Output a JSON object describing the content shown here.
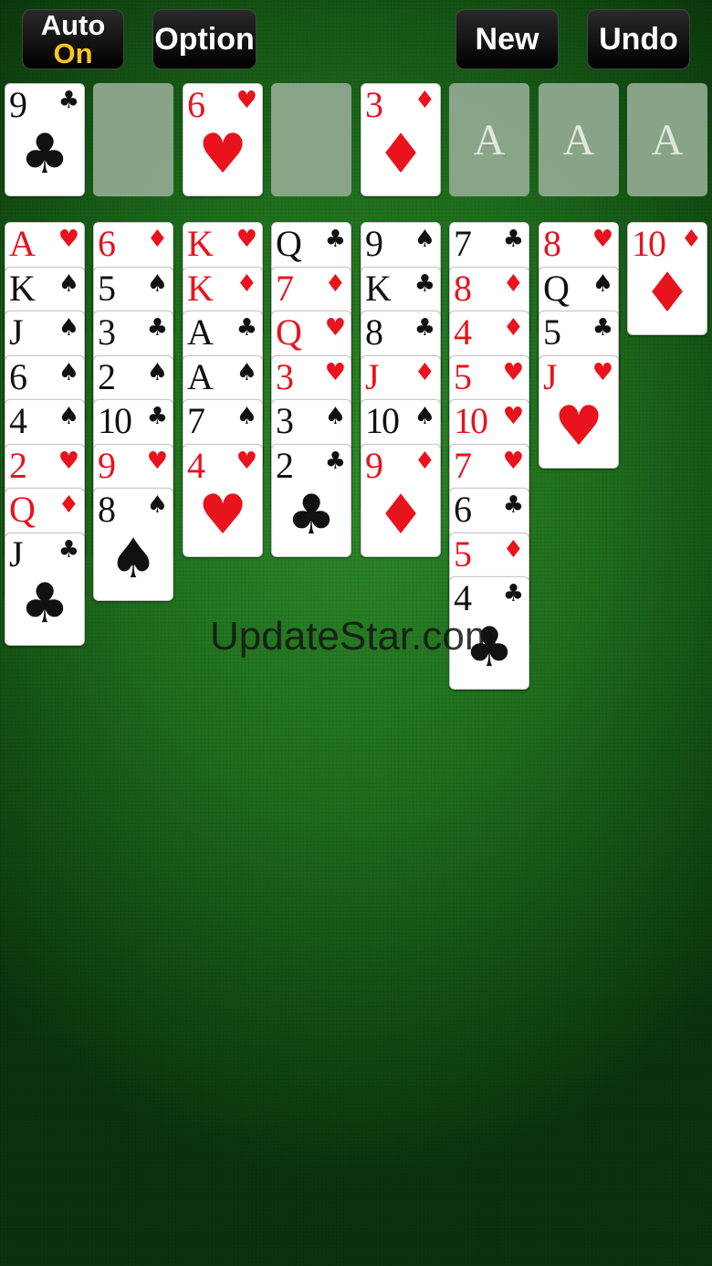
{
  "toolbar": {
    "auto_label": "Auto",
    "auto_state": "On",
    "option_label": "Option",
    "new_label": "New",
    "undo_label": "Undo"
  },
  "colors": {
    "felt": "#1f6e1d",
    "red_suit": "#e8131d",
    "black_suit": "#111111",
    "auto_state": "#ffc51a"
  },
  "freecells": [
    {
      "rank": "9",
      "suit": "♣",
      "color": "black"
    },
    null,
    {
      "rank": "6",
      "suit": "♥",
      "color": "red"
    },
    null
  ],
  "foundations": [
    {
      "rank": "3",
      "suit": "♦",
      "color": "red"
    },
    {
      "placeholder": "A"
    },
    {
      "placeholder": "A"
    },
    {
      "placeholder": "A"
    }
  ],
  "tableau": [
    [
      {
        "rank": "A",
        "suit": "♥",
        "color": "red"
      },
      {
        "rank": "K",
        "suit": "♠",
        "color": "black"
      },
      {
        "rank": "J",
        "suit": "♠",
        "color": "black"
      },
      {
        "rank": "6",
        "suit": "♠",
        "color": "black"
      },
      {
        "rank": "4",
        "suit": "♠",
        "color": "black"
      },
      {
        "rank": "2",
        "suit": "♥",
        "color": "red"
      },
      {
        "rank": "Q",
        "suit": "♦",
        "color": "red"
      },
      {
        "rank": "J",
        "suit": "♣",
        "color": "black"
      }
    ],
    [
      {
        "rank": "6",
        "suit": "♦",
        "color": "red"
      },
      {
        "rank": "5",
        "suit": "♠",
        "color": "black"
      },
      {
        "rank": "3",
        "suit": "♣",
        "color": "black"
      },
      {
        "rank": "2",
        "suit": "♠",
        "color": "black"
      },
      {
        "rank": "10",
        "suit": "♣",
        "color": "black"
      },
      {
        "rank": "9",
        "suit": "♥",
        "color": "red"
      },
      {
        "rank": "8",
        "suit": "♠",
        "color": "black"
      }
    ],
    [
      {
        "rank": "K",
        "suit": "♥",
        "color": "red"
      },
      {
        "rank": "K",
        "suit": "♦",
        "color": "red"
      },
      {
        "rank": "A",
        "suit": "♣",
        "color": "black"
      },
      {
        "rank": "A",
        "suit": "♠",
        "color": "black"
      },
      {
        "rank": "7",
        "suit": "♠",
        "color": "black"
      },
      {
        "rank": "4",
        "suit": "♥",
        "color": "red"
      }
    ],
    [
      {
        "rank": "Q",
        "suit": "♣",
        "color": "black"
      },
      {
        "rank": "7",
        "suit": "♦",
        "color": "red"
      },
      {
        "rank": "Q",
        "suit": "♥",
        "color": "red"
      },
      {
        "rank": "3",
        "suit": "♥",
        "color": "red"
      },
      {
        "rank": "3",
        "suit": "♠",
        "color": "black"
      },
      {
        "rank": "2",
        "suit": "♣",
        "color": "black"
      }
    ],
    [
      {
        "rank": "9",
        "suit": "♠",
        "color": "black"
      },
      {
        "rank": "K",
        "suit": "♣",
        "color": "black"
      },
      {
        "rank": "8",
        "suit": "♣",
        "color": "black"
      },
      {
        "rank": "J",
        "suit": "♦",
        "color": "red"
      },
      {
        "rank": "10",
        "suit": "♠",
        "color": "black"
      },
      {
        "rank": "9",
        "suit": "♦",
        "color": "red"
      }
    ],
    [
      {
        "rank": "7",
        "suit": "♣",
        "color": "black"
      },
      {
        "rank": "8",
        "suit": "♦",
        "color": "red"
      },
      {
        "rank": "4",
        "suit": "♦",
        "color": "red"
      },
      {
        "rank": "5",
        "suit": "♥",
        "color": "red"
      },
      {
        "rank": "10",
        "suit": "♥",
        "color": "red"
      },
      {
        "rank": "7",
        "suit": "♥",
        "color": "red"
      },
      {
        "rank": "6",
        "suit": "♣",
        "color": "black"
      },
      {
        "rank": "5",
        "suit": "♦",
        "color": "red"
      },
      {
        "rank": "4",
        "suit": "♣",
        "color": "black"
      }
    ],
    [
      {
        "rank": "8",
        "suit": "♥",
        "color": "red"
      },
      {
        "rank": "Q",
        "suit": "♠",
        "color": "black"
      },
      {
        "rank": "5",
        "suit": "♣",
        "color": "black"
      },
      {
        "rank": "J",
        "suit": "♥",
        "color": "red"
      }
    ],
    [
      {
        "rank": "10",
        "suit": "♦",
        "color": "red"
      }
    ]
  ],
  "watermark": "UpdateStar.com"
}
